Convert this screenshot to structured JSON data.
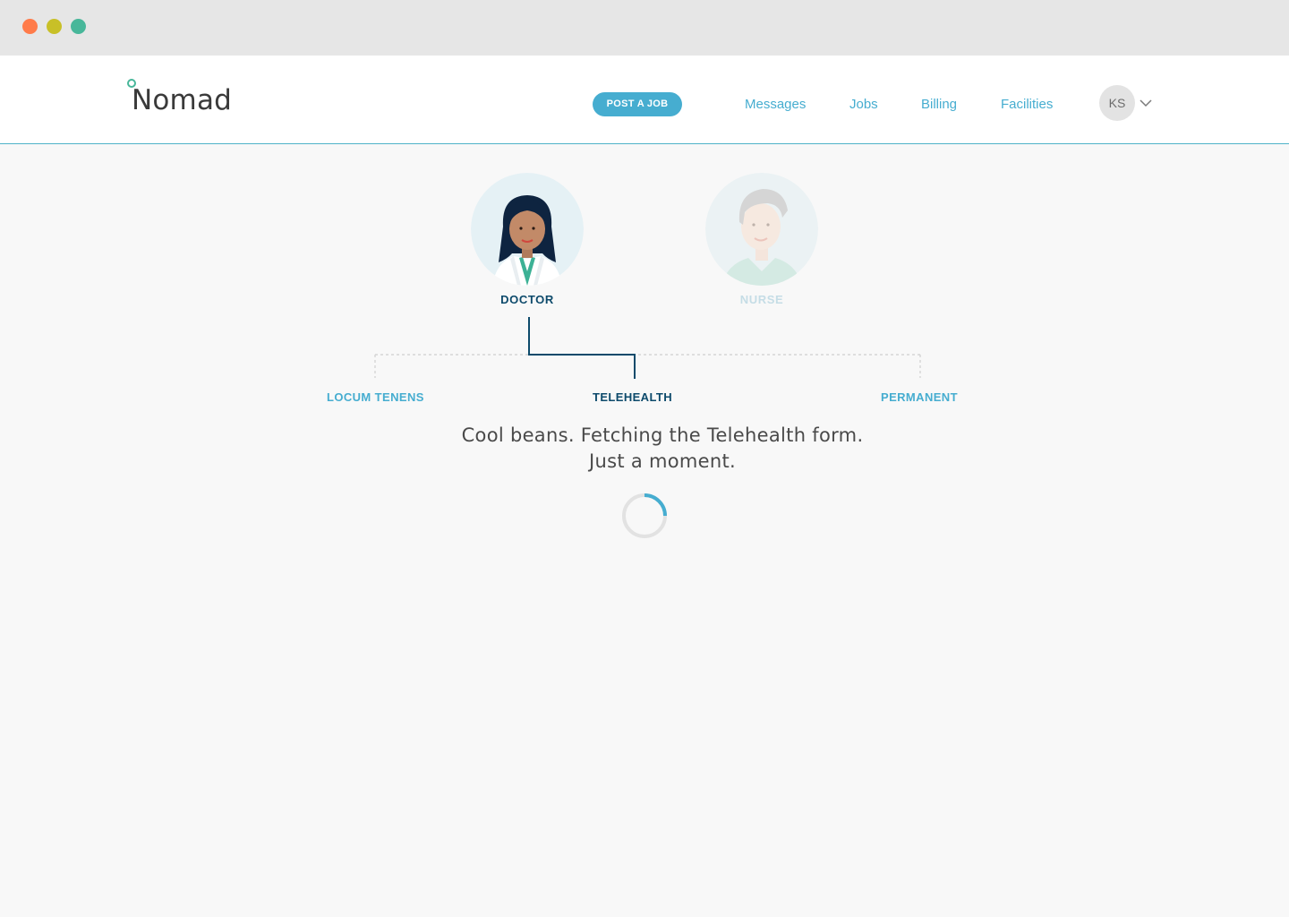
{
  "header": {
    "logo": "Nomad",
    "post_job_label": "POST A JOB",
    "nav": {
      "messages": "Messages",
      "jobs": "Jobs",
      "billing": "Billing",
      "facilities": "Facilities"
    },
    "user_initials": "KS"
  },
  "roles": {
    "doctor": "DOCTOR",
    "nurse": "NURSE",
    "selected": "doctor"
  },
  "job_types": {
    "locum": "LOCUM TENENS",
    "telehealth": "TELEHEALTH",
    "permanent": "PERMANENT",
    "selected": "telehealth"
  },
  "status": {
    "line1": "Cool beans. Fetching the Telehealth form.",
    "line2": "Just a moment."
  },
  "colors": {
    "accent": "#46add0",
    "dark_navy": "#0d4a6b",
    "disabled": "#c5dde6",
    "window_red": "#ff7b4a",
    "window_yellow": "#c8c027",
    "window_green": "#48b79a"
  },
  "icons": {
    "user_menu": "chevron-down-icon",
    "loading": "loading-spinner"
  }
}
